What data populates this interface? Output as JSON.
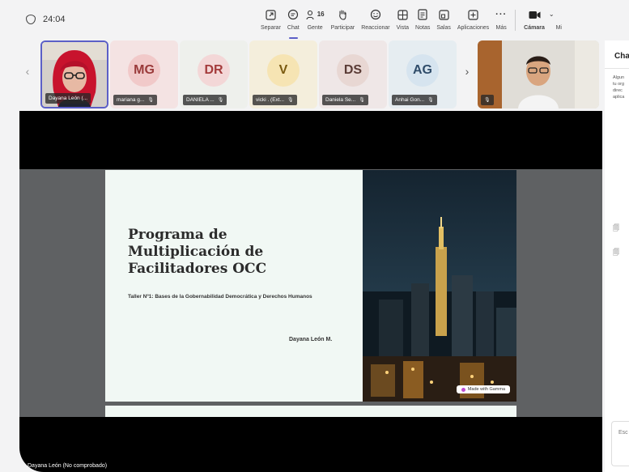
{
  "meeting": {
    "timer": "24:04"
  },
  "toolbar": {
    "items": [
      {
        "label": "Separar",
        "icon": "popout-icon"
      },
      {
        "label": "Chat",
        "icon": "chat-icon"
      },
      {
        "label": "Gente",
        "icon": "people-icon",
        "count": "16"
      },
      {
        "label": "Participar",
        "icon": "raise-hand-icon"
      },
      {
        "label": "Reaccionar",
        "icon": "react-icon"
      },
      {
        "label": "Vista",
        "icon": "view-icon"
      },
      {
        "label": "Notas",
        "icon": "notes-icon"
      },
      {
        "label": "Salas",
        "icon": "rooms-icon"
      },
      {
        "label": "Aplicaciones",
        "icon": "apps-icon"
      },
      {
        "label": "Más",
        "icon": "more-icon"
      }
    ],
    "camera_label": "Cámara",
    "mic_label": "Mi"
  },
  "participants": [
    {
      "name": "Dayana León (...",
      "initials": "",
      "video": true
    },
    {
      "name": "mariana g...",
      "initials": "MG",
      "bg": "#f4e3e3",
      "circle": "#f1c9c9",
      "color": "#9a3a3a"
    },
    {
      "name": "DANIELA ...",
      "initials": "DR",
      "bg": "#eef0ec",
      "circle": "#f3d7d7",
      "color": "#a43b3b"
    },
    {
      "name": "vicki . (Ext...",
      "initials": "V",
      "bg": "#f4eedc",
      "circle": "#f6e4b3",
      "color": "#7a5a10"
    },
    {
      "name": "Daniela Se...",
      "initials": "DS",
      "bg": "#efe7e7",
      "circle": "#e8d7d3",
      "color": "#5a3b35"
    },
    {
      "name": "Anhai Gon...",
      "initials": "AG",
      "bg": "#e6edf1",
      "circle": "#d6e4ef",
      "color": "#2f4c6a"
    },
    {
      "name": "",
      "initials": "",
      "video": true
    }
  ],
  "slide": {
    "title": "Programa de Multiplicación de Facilitadores OCC",
    "subtitle": "Taller Nº1: Bases de la Gobernabilidad Democrática y Derechos Humanos",
    "author": "Dayana León M.",
    "badge": "Made with Gamma"
  },
  "stage": {
    "presenter_label": "Dayana León (No comprobado)"
  },
  "chat": {
    "title": "Cha",
    "notice_lines": [
      "Algun",
      "tu org",
      "direc",
      "aplica"
    ],
    "input_placeholder": "Esc"
  },
  "colors": {
    "accent": "#5b5fc7",
    "stage_bg": "#000000",
    "slide_bg": "#f1f8f4"
  }
}
